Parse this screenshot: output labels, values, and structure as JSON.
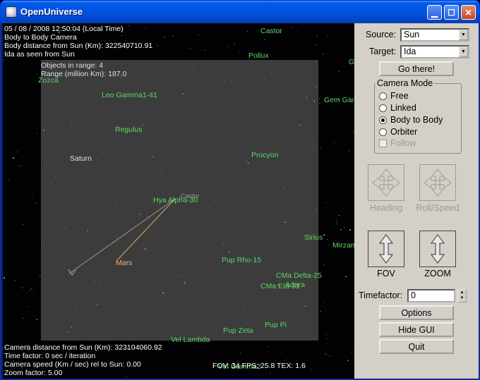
{
  "window": {
    "title": "OpenUniverse"
  },
  "viewport": {
    "info_top": [
      "05 / 08 / 2008  12:50:04 (Local Time)",
      "Body to Body Camera",
      "Body distance from Sun (Km): 322540710.91",
      "Ida as seen from Sun"
    ],
    "range_info": [
      "Objects in range: 4",
      "Range (million Km): 187.0"
    ],
    "info_bottom": [
      "Camera distance from Sun (Km): 323104060.92",
      "Time factor: 0 sec / iteration",
      "Camera speed (Km / sec) rel to Sun: 0.00",
      "Zoom factor: 5.00"
    ],
    "stats": "FOV: 34     FPS: 25.8  TEX: 1.6",
    "labels": [
      {
        "text": "Castor",
        "color": "green"
      },
      {
        "text": "Pollux",
        "color": "green"
      },
      {
        "text": "G",
        "color": "green"
      },
      {
        "text": "Zozca",
        "color": "green"
      },
      {
        "text": "Leo Gamma1-41",
        "color": "green"
      },
      {
        "text": "Gem Gam",
        "color": "green"
      },
      {
        "text": "Regulus",
        "color": "green"
      },
      {
        "text": "Saturn",
        "color": "white"
      },
      {
        "text": "Procyon",
        "color": "green"
      },
      {
        "text": "Hya Alpha-30",
        "color": "green"
      },
      {
        "text": "Castor",
        "color": "gray"
      },
      {
        "text": "Sirius",
        "color": "green"
      },
      {
        "text": "Mirzam",
        "color": "green"
      },
      {
        "text": "Mars",
        "color": "orange"
      },
      {
        "text": "Pup Rho-15",
        "color": "green"
      },
      {
        "text": "CMa Delta-25",
        "color": "green"
      },
      {
        "text": "Adara",
        "color": "green"
      },
      {
        "text": "CMa Eta-31",
        "color": "green"
      },
      {
        "text": "Pup Pi",
        "color": "green"
      },
      {
        "text": "Pup Zeta",
        "color": "green"
      },
      {
        "text": "Vel Lambda",
        "color": "green"
      },
      {
        "text": "Vel Gamma2",
        "color": "green"
      }
    ]
  },
  "panel": {
    "source_label": "Source:",
    "source_value": "Sun",
    "target_label": "Target:",
    "target_value": "Ida",
    "go_button": "Go there!",
    "camera_mode": {
      "title": "Camera Mode",
      "options": [
        "Free",
        "Linked",
        "Body to Body",
        "Orbiter"
      ],
      "selected": "Body to Body",
      "follow_label": "Follow"
    },
    "heading_label": "Heading",
    "roll_label": "Roll/Speed",
    "fov_label": "FOV",
    "zoom_label": "ZOOM",
    "timefactor_label": "Timefactor:",
    "timefactor_value": "0",
    "options_button": "Options",
    "hide_gui_button": "Hide GUI",
    "quit_button": "Quit"
  }
}
